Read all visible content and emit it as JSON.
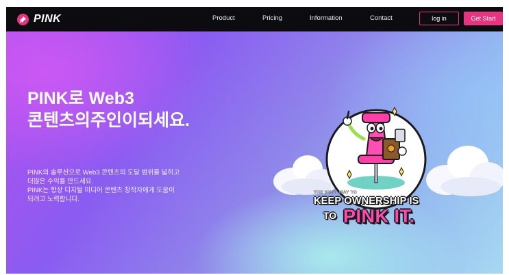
{
  "nav": {
    "brand": "PINK",
    "links": [
      "Product",
      "Pricing",
      "Information",
      "Contact"
    ],
    "login_label": "log in",
    "start_label": "Get Start"
  },
  "hero": {
    "title_lines": [
      "PINK로 Web3",
      "콘텐츠의주인이되세요."
    ],
    "description_lines": [
      "PINK의 솔루션으로 Web3 콘텐츠의 도달 범위를 넓히고",
      "더많은 수익을 만드세요.",
      "PINK는 항상 디지털 미디어 콘텐츠 창작자에게 도움이",
      "되려고 노력합니다."
    ]
  },
  "illustration": {
    "slogan_small": "THE BEST WAY TO",
    "slogan_mid": "KEEP OWNERSHIP IS",
    "slogan_to": "TO",
    "slogan_big": "PINK IT.",
    "icon": "pink-pushpin-mascot"
  },
  "colors": {
    "accent": "#e8347f",
    "nav_background": "#0c0c10",
    "hero_start": "#b34ff0",
    "hero_end": "#a6d8f2"
  }
}
